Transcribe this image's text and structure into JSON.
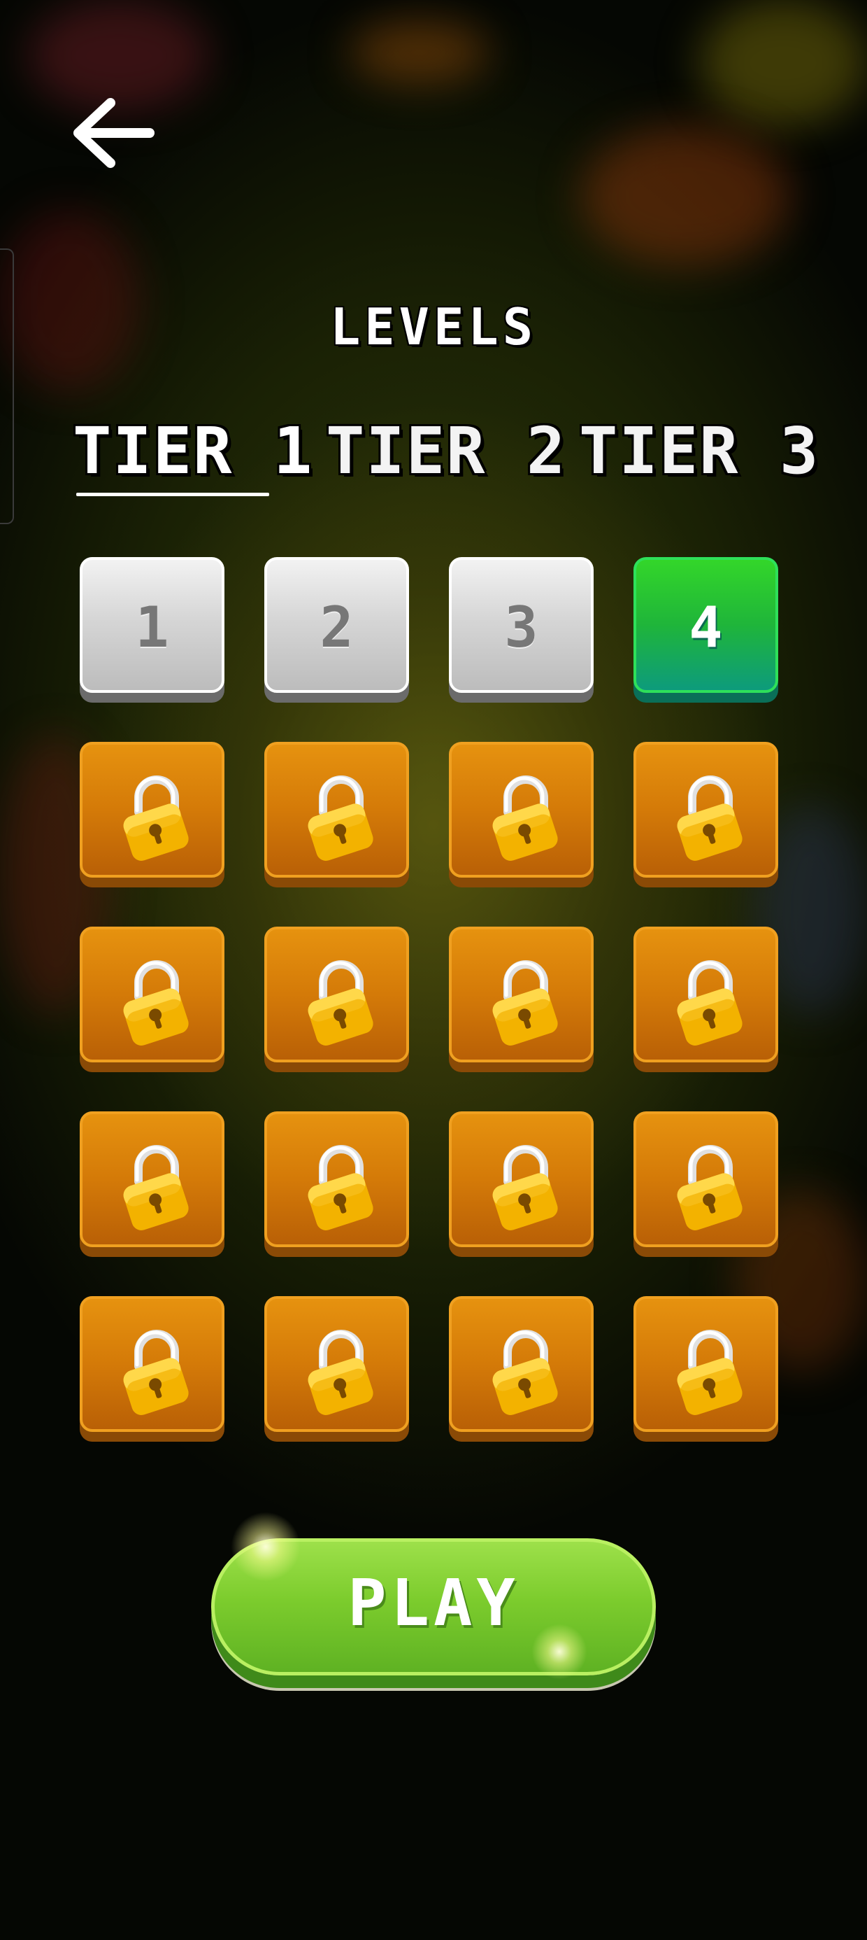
{
  "header": {
    "back_icon": "arrow-left-icon",
    "title": "LEVELS"
  },
  "tabs": [
    {
      "label": "TIER 1",
      "selected": true
    },
    {
      "label": "TIER 2",
      "selected": false
    },
    {
      "label": "TIER 3",
      "selected": false
    }
  ],
  "levels": [
    {
      "label": "1",
      "state": "completed"
    },
    {
      "label": "2",
      "state": "completed"
    },
    {
      "label": "3",
      "state": "completed"
    },
    {
      "label": "4",
      "state": "current"
    },
    {
      "label": "",
      "state": "locked",
      "icon": "padlock-icon"
    },
    {
      "label": "",
      "state": "locked",
      "icon": "padlock-icon"
    },
    {
      "label": "",
      "state": "locked",
      "icon": "padlock-icon"
    },
    {
      "label": "",
      "state": "locked",
      "icon": "padlock-icon"
    },
    {
      "label": "",
      "state": "locked",
      "icon": "padlock-icon"
    },
    {
      "label": "",
      "state": "locked",
      "icon": "padlock-icon"
    },
    {
      "label": "",
      "state": "locked",
      "icon": "padlock-icon"
    },
    {
      "label": "",
      "state": "locked",
      "icon": "padlock-icon"
    },
    {
      "label": "",
      "state": "locked",
      "icon": "padlock-icon"
    },
    {
      "label": "",
      "state": "locked",
      "icon": "padlock-icon"
    },
    {
      "label": "",
      "state": "locked",
      "icon": "padlock-icon"
    },
    {
      "label": "",
      "state": "locked",
      "icon": "padlock-icon"
    },
    {
      "label": "",
      "state": "locked",
      "icon": "padlock-icon"
    },
    {
      "label": "",
      "state": "locked",
      "icon": "padlock-icon"
    },
    {
      "label": "",
      "state": "locked",
      "icon": "padlock-icon"
    },
    {
      "label": "",
      "state": "locked",
      "icon": "padlock-icon"
    }
  ],
  "play_button": {
    "label": "PLAY"
  },
  "colors": {
    "current_level": "#1fb53a",
    "completed_level": "#d6d6d6",
    "locked_level": "#d47a08",
    "play_button": "#7ccc2d"
  }
}
